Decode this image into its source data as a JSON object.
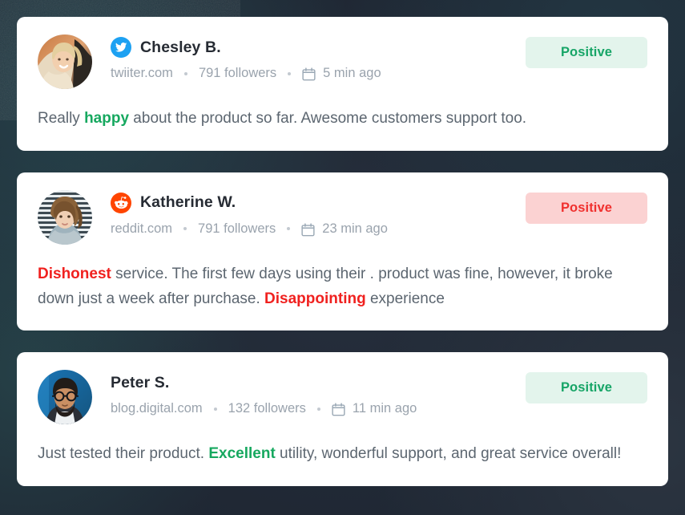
{
  "theme": {
    "background": "#2f3a49",
    "card_background": "#ffffff",
    "positive_badge_bg": "#e3f4ec",
    "positive_badge_text": "#17a567",
    "negative_badge_bg": "#fbd2d2",
    "negative_badge_text": "#f0312f",
    "positive_highlight": "#16a85f",
    "negative_highlight": "#f0211f",
    "meta_text": "#9aa3ad",
    "body_text": "#5c6670",
    "twitter_blue": "#1da1f2",
    "reddit_orange": "#ff4500"
  },
  "feed": {
    "posts": [
      {
        "author": "Chesley B.",
        "platform_icon": "twitter-icon",
        "avatar": "avatar-woman-blonde",
        "source": "twiiter.com",
        "followers": "791 followers",
        "time_icon": "calendar-icon",
        "time": "5 min ago",
        "badge": {
          "label": "Positive",
          "tone": "positive"
        },
        "body": [
          {
            "text": "Really ",
            "style": "plain"
          },
          {
            "text": "happy",
            "style": "positive"
          },
          {
            "text": " about the product so far. Awesome customers support too.",
            "style": "plain"
          }
        ]
      },
      {
        "author": "Katherine W.",
        "platform_icon": "reddit-icon",
        "avatar": "avatar-woman-brunette",
        "source": "reddit.com",
        "followers": "791 followers",
        "time_icon": "calendar-icon",
        "time": "23 min ago",
        "badge": {
          "label": "Positive",
          "tone": "negative"
        },
        "body": [
          {
            "text": "Dishonest",
            "style": "negative"
          },
          {
            "text": " service. The first few days using their . product was fine, however, it broke down just a week after purchase. ",
            "style": "plain"
          },
          {
            "text": "Disappointing",
            "style": "negative"
          },
          {
            "text": " experience",
            "style": "plain"
          }
        ]
      },
      {
        "author": "Peter S.",
        "platform_icon": "none",
        "avatar": "avatar-man-glasses",
        "source": "blog.digital.com",
        "followers": "132 followers",
        "time_icon": "calendar-icon",
        "time": "11 min ago",
        "badge": {
          "label": "Positive",
          "tone": "positive"
        },
        "body": [
          {
            "text": "Just tested their product. ",
            "style": "plain"
          },
          {
            "text": "Excellent",
            "style": "positive"
          },
          {
            "text": " utility, wonderful support, and great service overall!",
            "style": "plain"
          }
        ]
      }
    ]
  }
}
